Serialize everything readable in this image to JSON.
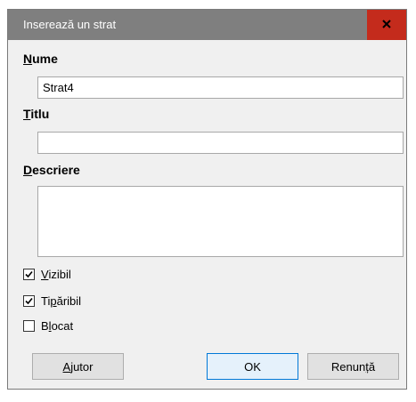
{
  "dialog": {
    "title": "Inserează un strat",
    "close_label": "x"
  },
  "fields": {
    "name_label_acc": "N",
    "name_label_rest": "ume",
    "name_value": "Strat4",
    "title_label_acc": "T",
    "title_label_rest": "itlu",
    "title_value": "",
    "description_label_acc": "D",
    "description_label_rest": "escriere",
    "description_value": ""
  },
  "checkboxes": [
    {
      "label_pre": "",
      "label_acc": "V",
      "label_post": "izibil",
      "checked": true
    },
    {
      "label_pre": "Ti",
      "label_acc": "p",
      "label_post": "ăribil",
      "checked": true
    },
    {
      "label_pre": "B",
      "label_acc": "l",
      "label_post": "ocat",
      "checked": false
    }
  ],
  "buttons": {
    "help_acc": "A",
    "help_rest": "jutor",
    "ok": "OK",
    "cancel_pre": "Renun",
    "cancel_acc": "ț",
    "cancel_post": "ă"
  }
}
